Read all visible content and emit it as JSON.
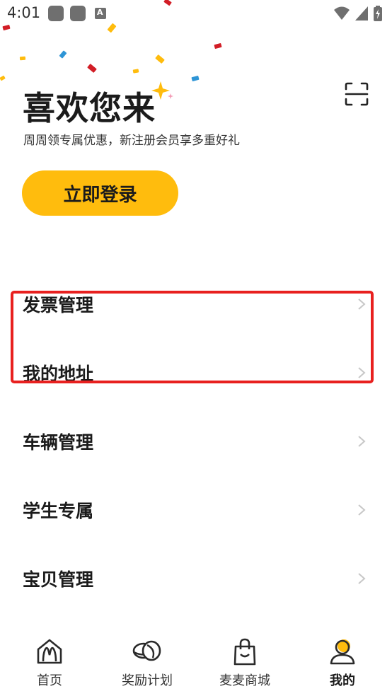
{
  "status_bar": {
    "time": "4:01"
  },
  "header": {
    "title": "喜欢您来",
    "subtitle": "周周领专属优惠，新注册会员享多重好礼",
    "login_label": "立即登录"
  },
  "menu": {
    "items": [
      {
        "label": "发票管理"
      },
      {
        "label": "我的地址"
      },
      {
        "label": "车辆管理"
      },
      {
        "label": "学生专属"
      },
      {
        "label": "宝贝管理"
      }
    ]
  },
  "bottom_nav": {
    "items": [
      {
        "label": "首页",
        "icon": "home-icon"
      },
      {
        "label": "奖励计划",
        "icon": "coins-icon"
      },
      {
        "label": "麦麦商城",
        "icon": "shopping-bag-icon"
      },
      {
        "label": "我的",
        "icon": "profile-icon",
        "active": true
      }
    ]
  },
  "colors": {
    "accent": "#ffbc0d",
    "highlight": "#e8201f",
    "text": "#1b1b1b"
  }
}
